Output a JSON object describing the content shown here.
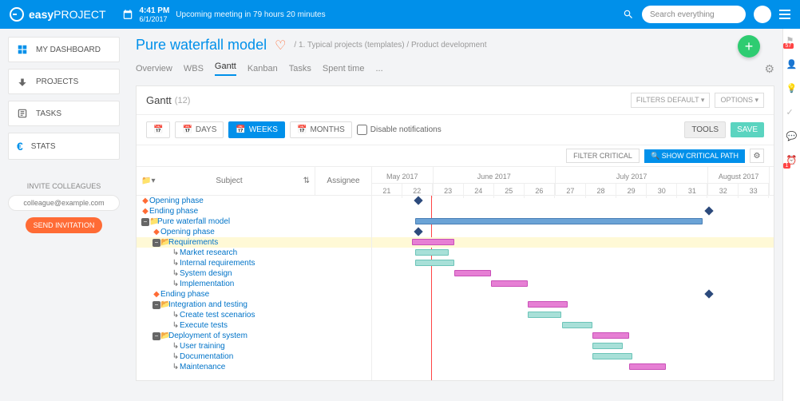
{
  "header": {
    "brand_bold": "easy",
    "brand_light": "PROJECT",
    "time": "4:41 PM",
    "date": "6/1/2017",
    "meeting": "Upcoming meeting in 79 hours 20 minutes",
    "search_placeholder": "Search everything"
  },
  "sidebar": {
    "items": [
      {
        "label": "MY DASHBOARD"
      },
      {
        "label": "PROJECTS"
      },
      {
        "label": "TASKS"
      },
      {
        "label": "STATS"
      }
    ],
    "invite_title": "INVITE COLLEAGUES",
    "invite_placeholder": "colleague@example.com",
    "invite_btn": "SEND INVITATION"
  },
  "page": {
    "title": "Pure waterfall model",
    "crumb1": "1. Typical projects (templates)",
    "crumb2": "Product development",
    "tabs": [
      "Overview",
      "WBS",
      "Gantt",
      "Kanban",
      "Tasks",
      "Spent time",
      "..."
    ],
    "active_tab": "Gantt"
  },
  "panel": {
    "title": "Gantt",
    "count": "(12)",
    "filters_label": "FILTERS DEFAULT",
    "options_label": "OPTIONS",
    "scale": {
      "days": "DAYS",
      "weeks": "WEEKS",
      "months": "MONTHS"
    },
    "disable_notif": "Disable notifications",
    "tools": "TOOLS",
    "save": "SAVE",
    "filter_critical": "FILTER CRITICAL",
    "show_critical": "SHOW CRITICAL PATH",
    "col_subject": "Subject",
    "col_assignee": "Assignee"
  },
  "timeline": {
    "months": [
      {
        "label": "May 2017",
        "weeks": [
          "21",
          "22"
        ]
      },
      {
        "label": "June 2017",
        "weeks": [
          "23",
          "24",
          "25",
          "26"
        ]
      },
      {
        "label": "July 2017",
        "weeks": [
          "27",
          "28",
          "29",
          "30",
          "31"
        ]
      },
      {
        "label": "August 2017",
        "weeks": [
          "32",
          "33"
        ]
      }
    ]
  },
  "tasks": [
    {
      "label": "Opening phase",
      "indent": 0,
      "type": "milestone"
    },
    {
      "label": "Ending phase",
      "indent": 0,
      "type": "milestone"
    },
    {
      "label": "Pure waterfall model",
      "indent": 0,
      "type": "project"
    },
    {
      "label": "Opening phase",
      "indent": 1,
      "type": "milestone"
    },
    {
      "label": "Requirements",
      "indent": 1,
      "type": "folder",
      "hl": true
    },
    {
      "label": "Market research",
      "indent": 2,
      "type": "task"
    },
    {
      "label": "Internal requirements",
      "indent": 2,
      "type": "task"
    },
    {
      "label": "System design",
      "indent": 2,
      "type": "task"
    },
    {
      "label": "Implementation",
      "indent": 2,
      "type": "task"
    },
    {
      "label": "Ending phase",
      "indent": 1,
      "type": "milestone"
    },
    {
      "label": "Integration and testing",
      "indent": 1,
      "type": "folder"
    },
    {
      "label": "Create test scenarios",
      "indent": 2,
      "type": "task"
    },
    {
      "label": "Execute tests",
      "indent": 2,
      "type": "task"
    },
    {
      "label": "Deployment of system",
      "indent": 1,
      "type": "folder"
    },
    {
      "label": "User training",
      "indent": 2,
      "type": "task"
    },
    {
      "label": "Documentation",
      "indent": 2,
      "type": "task"
    },
    {
      "label": "Maintenance",
      "indent": 2,
      "type": "task"
    }
  ],
  "rail_badges": {
    "flag": "57",
    "clock": "1"
  }
}
